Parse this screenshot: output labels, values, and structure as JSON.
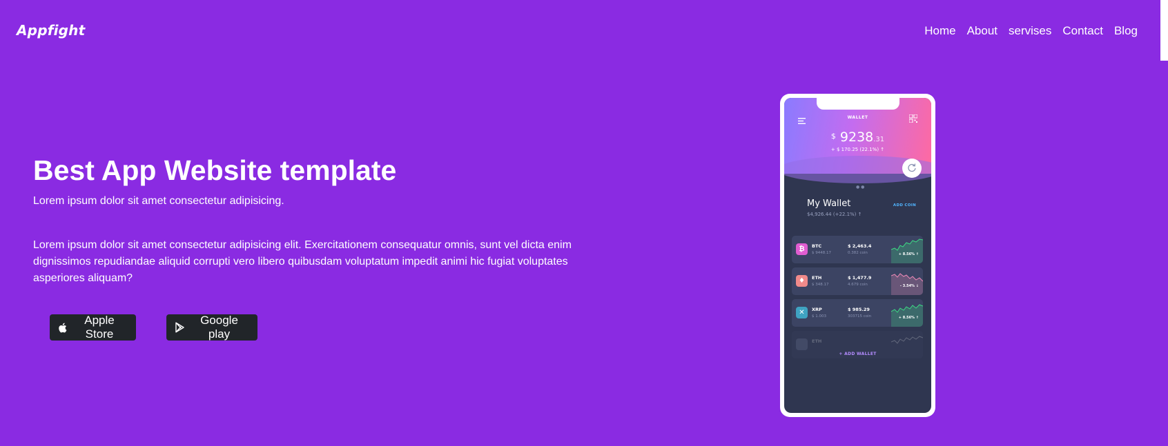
{
  "brand": {
    "logo": "Appfight"
  },
  "nav": {
    "items": [
      {
        "label": "Home"
      },
      {
        "label": "About"
      },
      {
        "label": "servises"
      },
      {
        "label": "Contact"
      },
      {
        "label": "Blog"
      }
    ]
  },
  "hero": {
    "title": "Best App Website template",
    "subtitle": "Lorem ipsum dolor sit amet consectetur adipisicing.",
    "description": "Lorem ipsum dolor sit amet consectetur adipisicing elit. Exercitationem consequatur omnis, sunt vel dicta enim dignissimos repudiandae aliquid corrupti vero libero quibusdam voluptatum impedit animi hic fugiat voluptates asperiores aliquam?",
    "buttons": {
      "apple": "Apple Store",
      "google": "Google play"
    }
  },
  "phone": {
    "header_label": "WALLET",
    "balance_currency": "$",
    "balance_main": "9238",
    "balance_decimal": ".31",
    "balance_change": "+ $ 170.25 (22.1%) ↑",
    "my_wallet_title": "My Wallet",
    "my_wallet_value": "$4,926.44 (+22.1%) ↑",
    "add_coin": "ADD COIN",
    "coins": [
      {
        "symbol": "BTC",
        "sub": "$ 9448.17",
        "value": "$ 2,463.4",
        "amount": "0.382 coin",
        "change": "+ 8.56% ↑",
        "color": "#e05dd0",
        "trend": "up"
      },
      {
        "symbol": "ETH",
        "sub": "$ 348.17",
        "value": "$ 1,477.9",
        "amount": "4.679 coin",
        "change": "- 3.54% ↓",
        "color": "#f08a8a",
        "trend": "down"
      },
      {
        "symbol": "XRP",
        "sub": "$ 1.003",
        "value": "$ 985.29",
        "amount": "303715 coin",
        "change": "+ 8.56% ↑",
        "color": "#3fa3c2",
        "trend": "up"
      },
      {
        "symbol": "ETH",
        "sub": "",
        "value": "",
        "amount": "",
        "change": "",
        "color": "#7c86a8",
        "trend": "up"
      }
    ],
    "add_wallet": "+ ADD WALLET"
  },
  "colors": {
    "background": "#8a2be2",
    "button_bg": "#212529",
    "chart_up": "#3ddc84",
    "chart_down": "#f08ab8"
  }
}
